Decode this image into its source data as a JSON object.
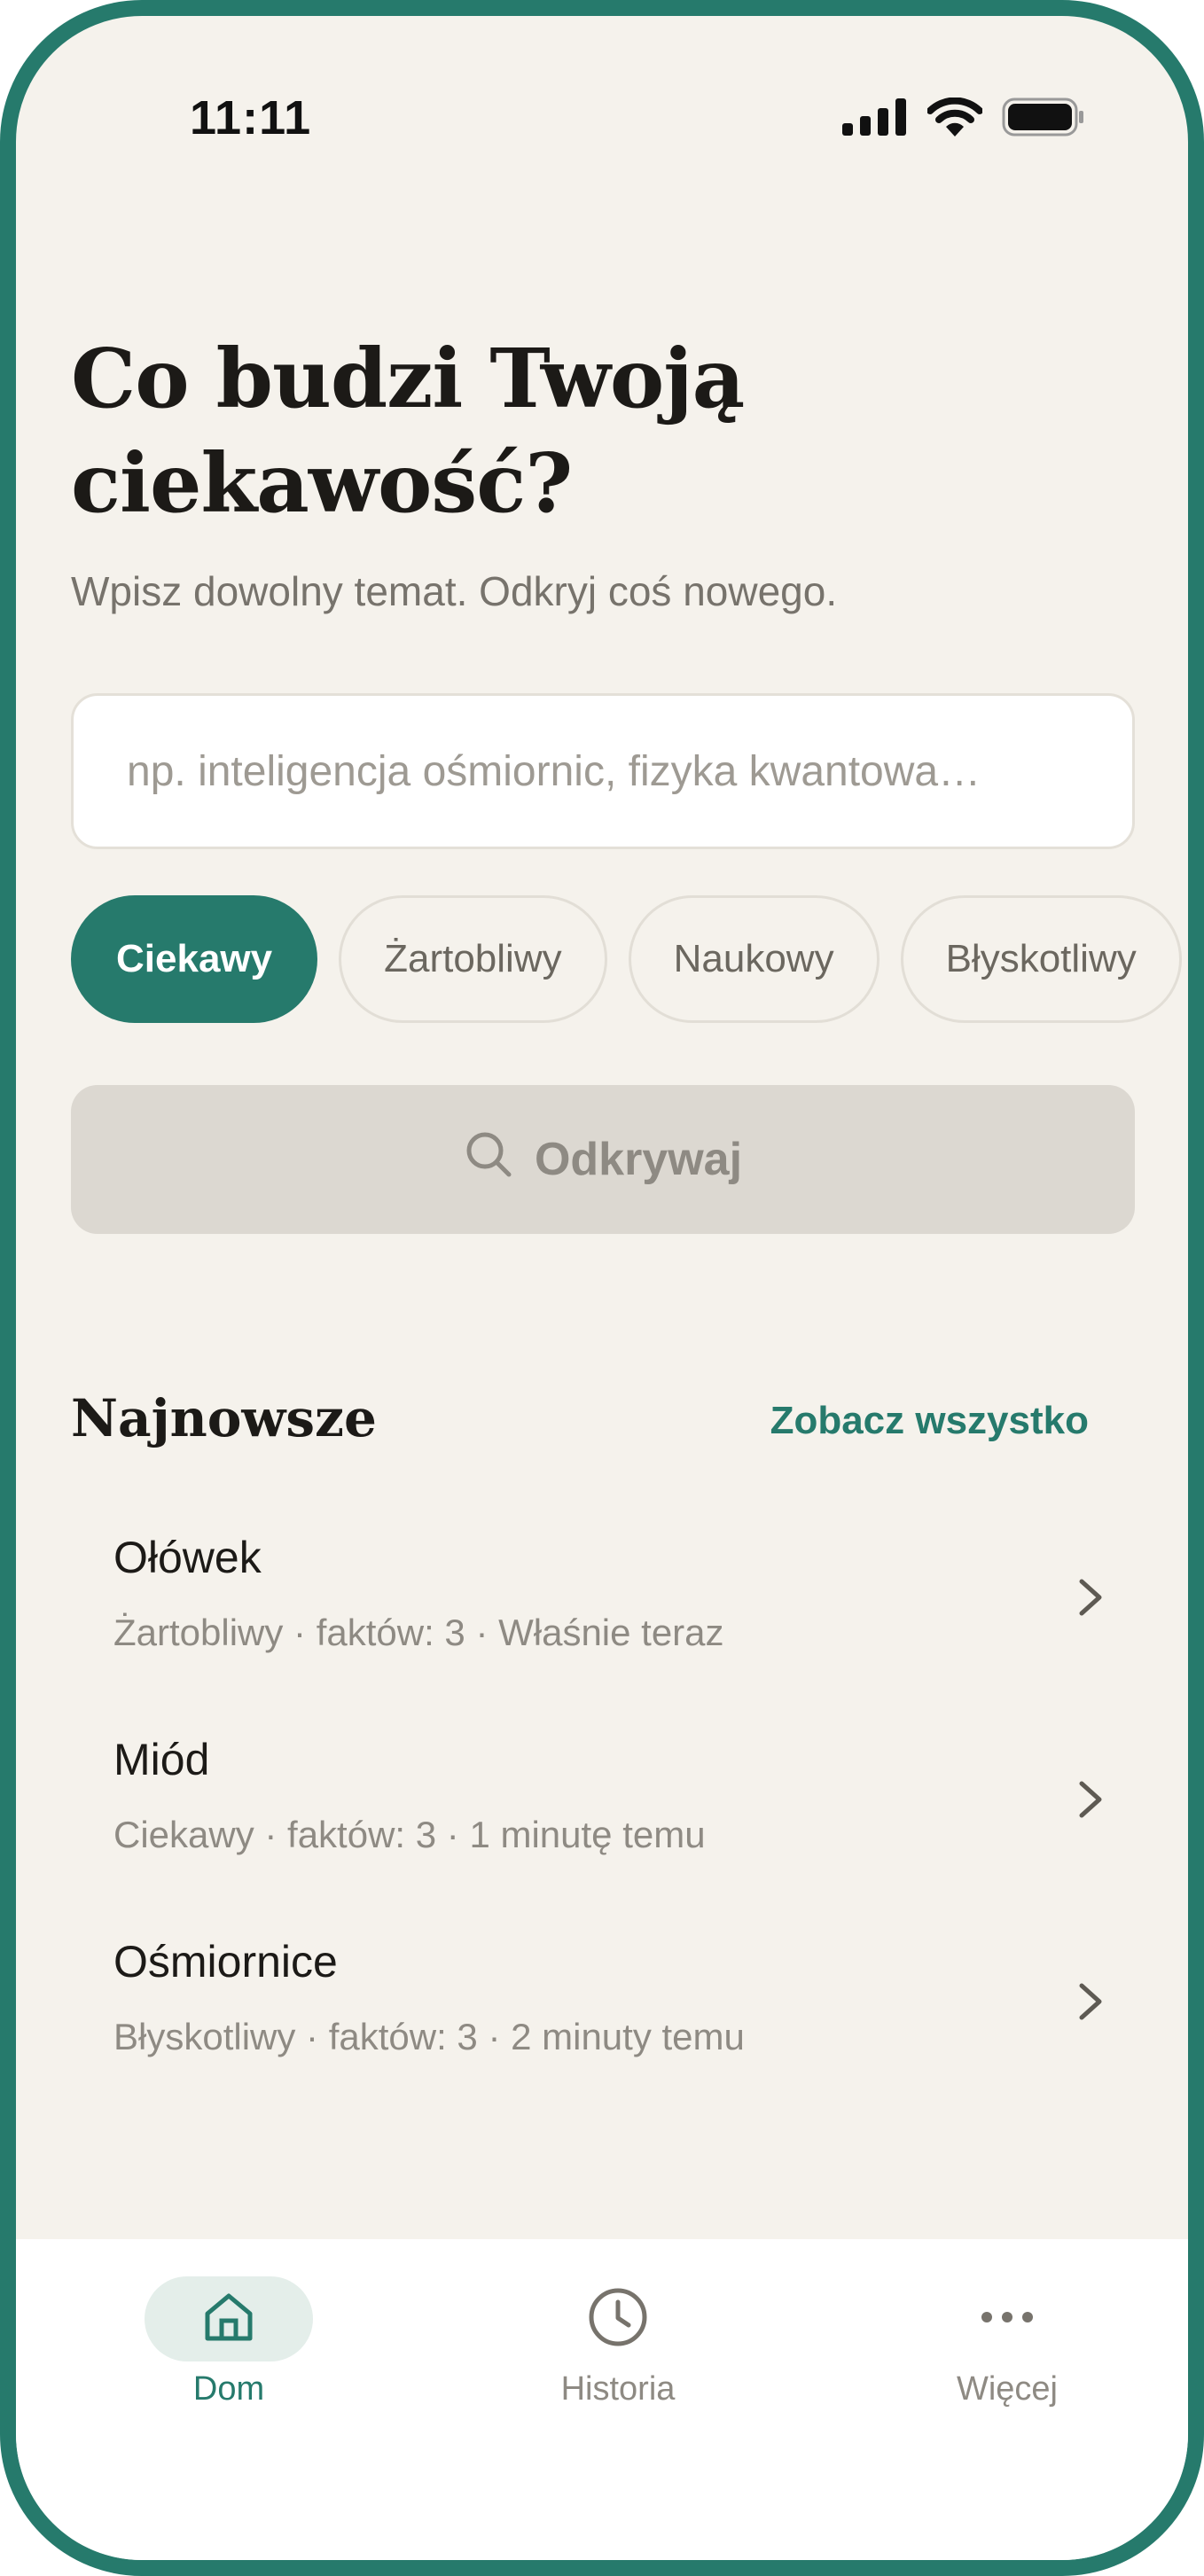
{
  "status_bar": {
    "time": "11:11",
    "signal_icon": "cellular-signal-icon",
    "wifi_icon": "wifi-icon",
    "battery_icon": "battery-icon"
  },
  "header": {
    "title_line1": "Co budzi Twoją",
    "title_line2": "ciekawość?",
    "subtitle": "Wpisz dowolny temat. Odkryj coś nowego."
  },
  "search": {
    "value": "",
    "placeholder": "np. inteligencja ośmiornic, fizyka kwantowa…"
  },
  "chips": [
    {
      "label": "Ciekawy",
      "active": true
    },
    {
      "label": "Żartobliwy",
      "active": false
    },
    {
      "label": "Naukowy",
      "active": false
    },
    {
      "label": "Błyskotliwy",
      "active": false
    }
  ],
  "discover_button": {
    "label": "Odkrywaj",
    "icon": "search-icon"
  },
  "recent": {
    "title": "Najnowsze",
    "see_all": "Zobacz wszystko",
    "items": [
      {
        "title": "Ołówek",
        "meta": "Żartobliwy · faktów: 3 · Właśnie teraz"
      },
      {
        "title": "Miód",
        "meta": "Ciekawy · faktów: 3 · 1 minutę temu"
      },
      {
        "title": "Ośmiornice",
        "meta": "Błyskotliwy · faktów: 3 · 2 minuty temu"
      }
    ]
  },
  "bottom_nav": {
    "items": [
      {
        "label": "Dom",
        "icon": "home-icon",
        "active": true
      },
      {
        "label": "Historia",
        "icon": "clock-icon",
        "active": false
      },
      {
        "label": "Więcej",
        "icon": "more-dots-icon",
        "active": false
      }
    ]
  },
  "colors": {
    "accent": "#267A6C",
    "background": "#F5F2EC",
    "disabled_button": "#DCD8D1"
  }
}
